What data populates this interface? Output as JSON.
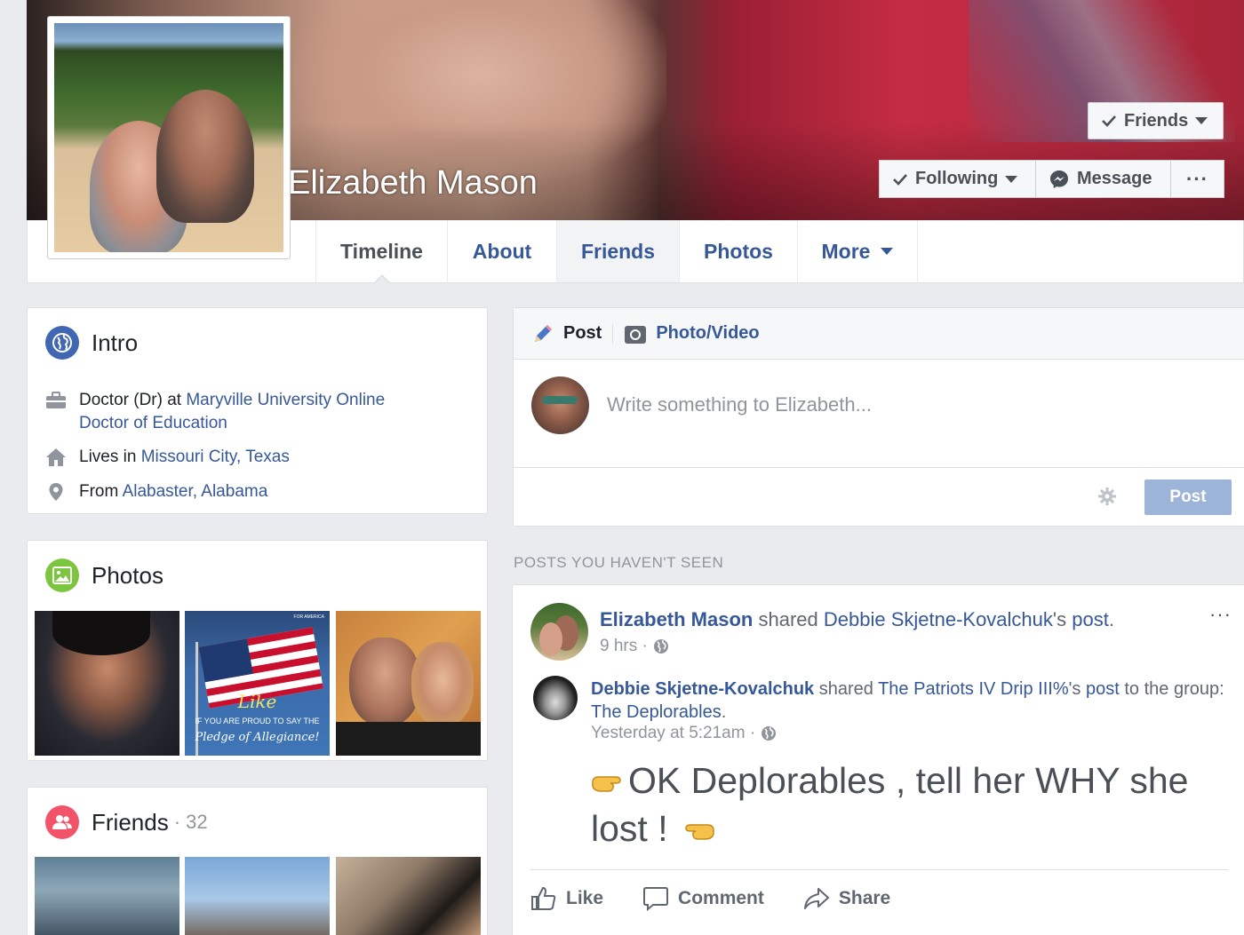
{
  "profile": {
    "name": "Elizabeth Mason",
    "buttons": {
      "friends": "Friends",
      "following": "Following",
      "message": "Message",
      "more": "···"
    }
  },
  "tabs": [
    {
      "label": "Timeline",
      "active": true
    },
    {
      "label": "About"
    },
    {
      "label": "Friends"
    },
    {
      "label": "Photos"
    },
    {
      "label": "More"
    }
  ],
  "intro": {
    "title": "Intro",
    "work_prefix": "Doctor (Dr) at ",
    "work_link_line1": "Maryville University Online",
    "work_link_line2": "Doctor of Education",
    "lives_prefix": "Lives in ",
    "lives_link": "Missouri City, Texas",
    "from_prefix": "From ",
    "from_link": "Alabaster, Alabama"
  },
  "photos": {
    "title": "Photos",
    "flag_caption_script": "Like",
    "flag_caption_line1": "IF YOU ARE PROUD TO SAY THE",
    "flag_caption_line2": "Pledge of Allegiance!",
    "flag_brand": "FOR AMERICA"
  },
  "friends": {
    "title": "Friends",
    "count": "· 32"
  },
  "composer": {
    "post_tab": "Post",
    "photo_tab": "Photo/Video",
    "placeholder": "Write something to Elizabeth...",
    "post_button": "Post"
  },
  "feed": {
    "section_label": "POSTS YOU HAVEN'T SEEN",
    "post": {
      "author": "Elizabeth Mason",
      "shared_word": " shared ",
      "original_author": "Debbie Skjetne-Kovalchuk",
      "possessive": "'s ",
      "post_word": "post",
      "period": ".",
      "time": "9 hrs ·",
      "inner": {
        "author": "Debbie Skjetne-Kovalchuk",
        "shared_word": " shared ",
        "source": "The Patriots IV Drip III%",
        "possessive": "'s ",
        "post_word": "post",
        "to_group": " to the group:",
        "group": "The Deplorables",
        "period": ".",
        "time": "Yesterday at 5:21am ·"
      },
      "text_line1": "OK Deplorables , tell her WHY she",
      "text_line2": "lost !",
      "actions": {
        "like": "Like",
        "comment": "Comment",
        "share": "Share"
      }
    }
  },
  "colors": {
    "link": "#365899",
    "page_bg": "#e9ebee",
    "post_button_disabled": "#9cb4d8"
  }
}
